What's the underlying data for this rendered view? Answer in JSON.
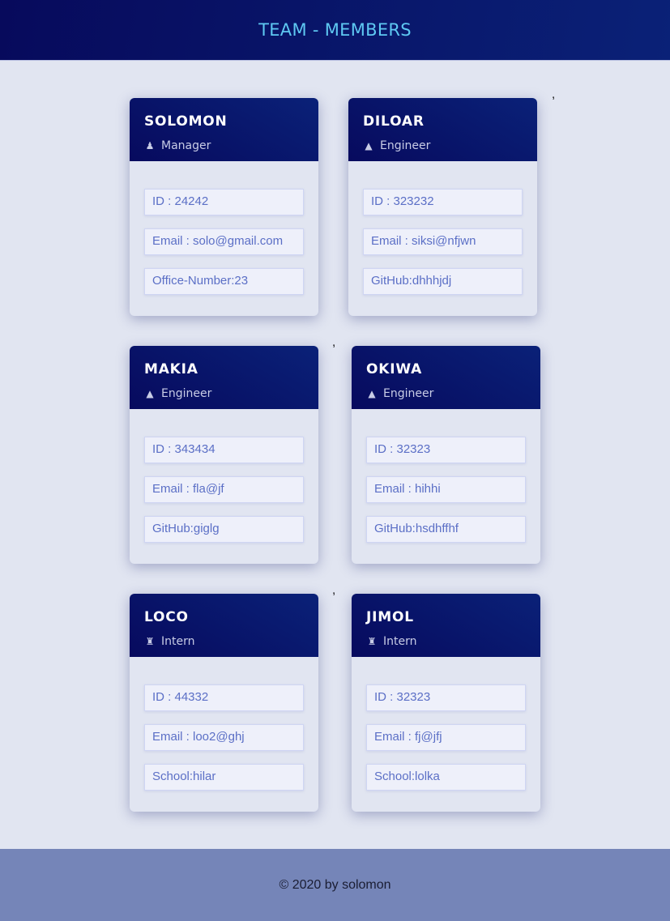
{
  "header": {
    "title": "TEAM - MEMBERS"
  },
  "separator": ",",
  "members": [
    {
      "name": "SOLOMON",
      "role": "Manager",
      "icon": "manager-icon",
      "id": "ID : 24242",
      "email": "Email : solo@gmail.com",
      "extra": "Office-Number:23"
    },
    {
      "name": "DILOAR",
      "role": "Engineer",
      "icon": "engineer-icon",
      "id": "ID : 323232",
      "email": "Email : siksi@nfjwn",
      "extra": "GitHub:dhhhjdj"
    },
    {
      "name": "MAKIA",
      "role": "Engineer",
      "icon": "engineer-icon",
      "id": "ID : 343434",
      "email": "Email : fla@jf",
      "extra": "GitHub:giglg"
    },
    {
      "name": "OKIWA",
      "role": "Engineer",
      "icon": "engineer-icon",
      "id": "ID : 32323",
      "email": "Email : hihhi",
      "extra": "GitHub:hsdhffhf"
    },
    {
      "name": "LOCO",
      "role": "Intern",
      "icon": "intern-icon",
      "id": "ID : 44332",
      "email": "Email : loo2@ghj",
      "extra": "School:hilar"
    },
    {
      "name": "JIMOL",
      "role": "Intern",
      "icon": "intern-icon",
      "id": "ID : 32323",
      "email": "Email : fj@jfj",
      "extra": "School:lolka"
    }
  ],
  "footer": {
    "text": "© 2020 by solomon"
  }
}
